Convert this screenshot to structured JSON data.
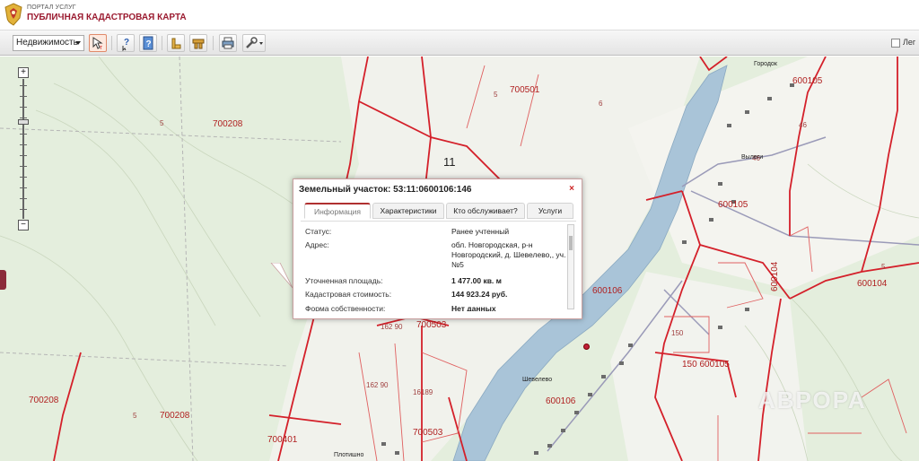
{
  "header": {
    "portal_small": "ПОРТАЛ УСЛУГ",
    "portal_title": "ПУБЛИЧНАЯ КАДАСТРОВАЯ КАРТА"
  },
  "toolbar": {
    "layer_select_value": "Недвижимость",
    "legend_label": "Лег",
    "buttons": [
      {
        "name": "select-object-button",
        "icon": "cursor-arrow-icon"
      },
      {
        "name": "identify-button",
        "icon": "question-cursor-icon"
      },
      {
        "name": "info-button",
        "icon": "info-document-icon"
      },
      {
        "name": "measure-button",
        "icon": "ruler-icon"
      },
      {
        "name": "layers-button",
        "icon": "building-icon"
      },
      {
        "name": "print-button",
        "icon": "printer-icon"
      },
      {
        "name": "tools-button",
        "icon": "wrench-icon"
      }
    ]
  },
  "map": {
    "labels": [
      {
        "text": "700501"
      },
      {
        "text": "5"
      },
      {
        "text": "700208"
      },
      {
        "text": "5"
      },
      {
        "text": "6"
      },
      {
        "text": "11"
      },
      {
        "text": "600105"
      },
      {
        "text": "46"
      },
      {
        "text": "46"
      },
      {
        "text": "600105"
      },
      {
        "text": "600106"
      },
      {
        "text": "600104"
      },
      {
        "text": "600104"
      },
      {
        "text": "5"
      },
      {
        "text": "700503"
      },
      {
        "text": "16189"
      },
      {
        "text": "700503"
      },
      {
        "text": "162 90"
      },
      {
        "text": "162 90"
      },
      {
        "text": "700208"
      },
      {
        "text": "5"
      },
      {
        "text": "700208"
      },
      {
        "text": "700401"
      },
      {
        "text": "600106"
      },
      {
        "text": "150"
      },
      {
        "text": "150 600105"
      },
      {
        "text": "Городок"
      },
      {
        "text": "Вылеги"
      },
      {
        "text": "Шевелево"
      },
      {
        "text": "Плотишно"
      }
    ]
  },
  "popup": {
    "title": "Земельный участок: 53:11:0600106:146",
    "tabs": [
      "Информация",
      "Характеристики",
      "Кто обслуживает?",
      "Услуги"
    ],
    "rows": [
      {
        "key": "Статус:",
        "value": "Ранее учтенный"
      },
      {
        "key": "Адрес:",
        "value": "обл. Новгородская, р-н Новгородский, д. Шевелево,, уч.№5"
      },
      {
        "key": "Уточненная площадь:",
        "value": "1 477.00 кв. м"
      },
      {
        "key": "Кадастровая стоимость:",
        "value": "144 923.24 руб."
      },
      {
        "key": "Форма собственности:",
        "value": "Нет данных"
      }
    ]
  },
  "watermark": "АВРОРА",
  "colors": {
    "boundary": "#d4202a",
    "river": "#a9c4d8",
    "forest": "#d8e8cf",
    "field": "#f3f3ef",
    "title_red": "#9b1b30"
  }
}
